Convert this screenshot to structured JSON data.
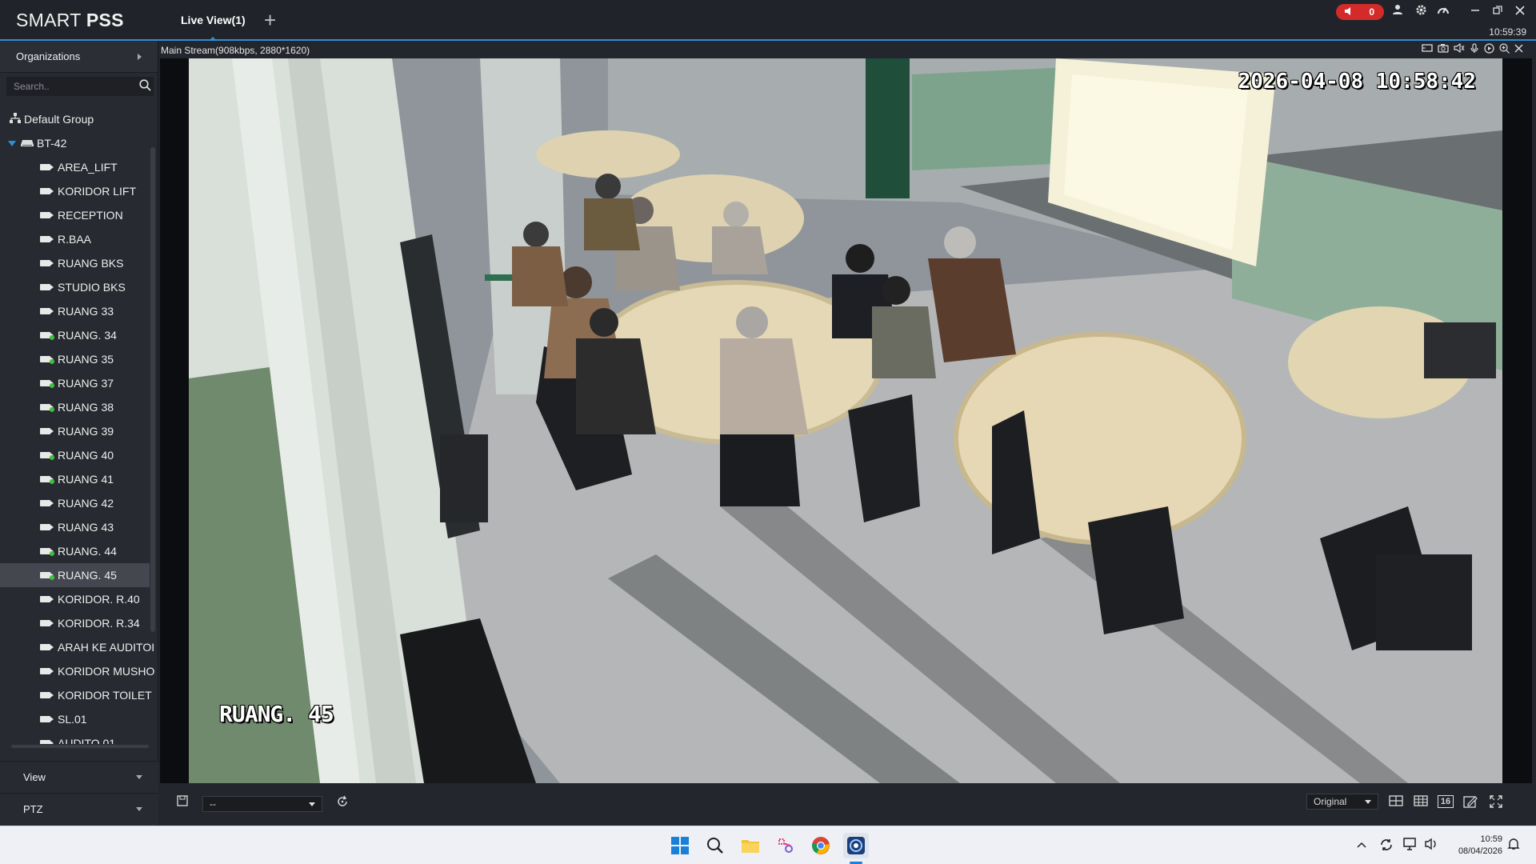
{
  "app": {
    "logo_prefix": "SMART ",
    "logo_bold": "PSS",
    "tab_label": "Live View(1)",
    "add_tab": "+",
    "alarm_count": "0",
    "clock": "10:59:39"
  },
  "sidebar": {
    "organizations_label": "Organizations",
    "search_placeholder": "Search..",
    "group_label": "Default Group",
    "device_label": "BT-42",
    "cameras": [
      {
        "label": "AREA_LIFT",
        "online": false
      },
      {
        "label": "KORIDOR LIFT",
        "online": false
      },
      {
        "label": "RECEPTION",
        "online": false
      },
      {
        "label": "R.BAA",
        "online": false
      },
      {
        "label": "RUANG BKS",
        "online": false
      },
      {
        "label": "STUDIO BKS",
        "online": false
      },
      {
        "label": "RUANG 33",
        "online": false
      },
      {
        "label": "RUANG. 34",
        "online": true
      },
      {
        "label": "RUANG 35",
        "online": true
      },
      {
        "label": "RUANG  37",
        "online": true
      },
      {
        "label": "RUANG 38",
        "online": true
      },
      {
        "label": "RUANG 39",
        "online": false
      },
      {
        "label": "RUANG 40",
        "online": true
      },
      {
        "label": "RUANG 41",
        "online": true
      },
      {
        "label": "RUANG 42",
        "online": false
      },
      {
        "label": "RUANG 43",
        "online": false
      },
      {
        "label": "RUANG. 44",
        "online": true
      },
      {
        "label": "RUANG. 45",
        "online": true,
        "selected": true
      },
      {
        "label": "KORIDOR. R.40",
        "online": false
      },
      {
        "label": "KORIDOR. R.34",
        "online": false
      },
      {
        "label": "ARAH KE AUDITOI",
        "online": false
      },
      {
        "label": "KORIDOR MUSHO",
        "online": false
      },
      {
        "label": "KORIDOR TOILET",
        "online": false
      },
      {
        "label": "SL.01",
        "online": false
      },
      {
        "label": "AUDITO 01",
        "online": false
      }
    ],
    "view_label": "View",
    "ptz_label": "PTZ"
  },
  "video": {
    "stream_info": "Main Stream(908kbps, 2880*1620)",
    "osd_timestamp": "2026-04-08 10:58:42",
    "osd_channel": "RUANG. 45"
  },
  "bottom": {
    "preset_value": "--",
    "scale_value": "Original",
    "layout_16": "16"
  },
  "taskbar": {
    "time": "10:59",
    "date": "08/04/2026"
  },
  "colors": {
    "accent": "#2c8fd6",
    "alarm": "#d32a2a",
    "online": "#3cc23c"
  }
}
